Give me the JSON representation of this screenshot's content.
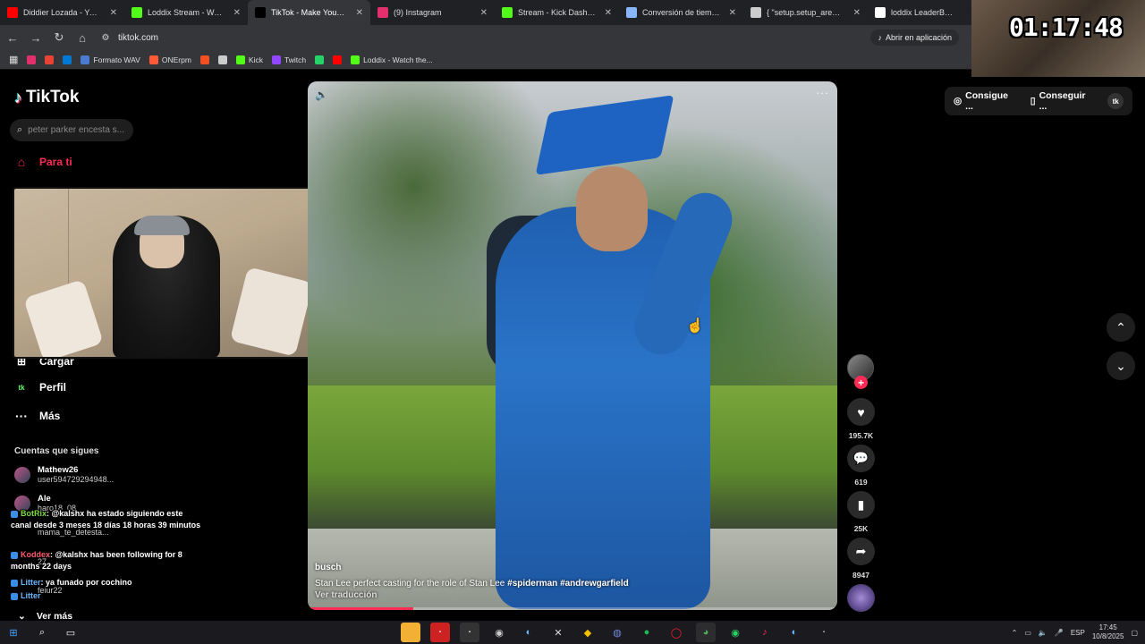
{
  "browser": {
    "tabs": [
      {
        "title": "Diddier Lozada - YouTube",
        "icon": "youtube-icon",
        "color": "#ff0000",
        "active": false
      },
      {
        "title": "Loddix Stream - Watch Live",
        "icon": "kick-icon",
        "color": "#53fc18",
        "active": false
      },
      {
        "title": "TikTok - Make Your Day",
        "icon": "tiktok-icon",
        "color": "#000000",
        "active": true
      },
      {
        "title": "(9) Instagram",
        "icon": "instagram-icon",
        "color": "#e1306c",
        "active": false
      },
      {
        "title": "Stream - Kick Dashboard",
        "icon": "kick-icon",
        "color": "#53fc18",
        "active": false
      },
      {
        "title": "Conversión de tiempo",
        "icon": "globe-icon",
        "color": "#8ab4f8",
        "active": false
      },
      {
        "title": "{ \"setup.setup_area_min_p",
        "icon": "document-icon",
        "color": "#cccccc",
        "active": false
      },
      {
        "title": "loddix LeaderBoard",
        "icon": "diamond-icon",
        "color": "#ffffff",
        "active": false
      }
    ],
    "url": "tiktok.com",
    "open_app_label": "Abrir en aplicación",
    "bookmarks": [
      {
        "label": "",
        "icon": "instagram-icon",
        "color": "#e1306c"
      },
      {
        "label": "",
        "icon": "gmail-icon",
        "color": "#ea4335"
      },
      {
        "label": "",
        "icon": "outlook-icon",
        "color": "#0078d4"
      },
      {
        "label": "Formato WAV",
        "icon": "note-icon",
        "color": "#4a7bd0"
      },
      {
        "label": "ONErpm",
        "icon": "onerpm-icon",
        "color": "#ff5a36"
      },
      {
        "label": "",
        "icon": "microsoft-icon",
        "color": "#f25022"
      },
      {
        "label": "",
        "icon": "chatgpt-icon",
        "color": "#cccccc"
      },
      {
        "label": "Kick",
        "icon": "kick-icon",
        "color": "#53fc18"
      },
      {
        "label": "Twitch",
        "icon": "twitch-icon",
        "color": "#9146ff"
      },
      {
        "label": "",
        "icon": "whatsapp-icon",
        "color": "#25d366"
      },
      {
        "label": "",
        "icon": "youtube-icon",
        "color": "#ff0000"
      },
      {
        "label": "Loddix - Watch the...",
        "icon": "kick-icon",
        "color": "#53fc18"
      }
    ]
  },
  "overlay": {
    "timer": "01:17:48"
  },
  "tiktok": {
    "logo": "TikTok",
    "search_placeholder": "peter parker encesta s...",
    "nav": [
      {
        "label": "Para ti",
        "icon": "home-icon",
        "active": true
      },
      {
        "label": "Cargar",
        "icon": "upload-icon",
        "active": false
      },
      {
        "label": "Perfil",
        "icon": "profile-icon",
        "active": false
      },
      {
        "label": "Más",
        "icon": "more-icon",
        "active": false
      }
    ],
    "following_title": "Cuentas que sigues",
    "following": [
      {
        "name": "Mathew26",
        "sub": "user594729294948..."
      },
      {
        "name": "Ale",
        "sub": "haro18_08"
      },
      {
        "name": "",
        "sub": "mama_te_detesta..."
      },
      {
        "name": "",
        "sub": "27"
      },
      {
        "name": "",
        "sub": "feiur22"
      }
    ],
    "see_more": "Ver más",
    "top_buttons": [
      "Consigue ...",
      "Conseguir ..."
    ],
    "video": {
      "author": "busch",
      "caption": "Stan Lee perfect casting for the role of Stan Lee",
      "hashtags": [
        "#spiderman",
        "#andrewgarfield"
      ],
      "translate": "Ver traducción",
      "progress": 0.2
    },
    "actions": {
      "likes": "195.7K",
      "comments": "619",
      "saves": "25K",
      "shares": "8947"
    }
  },
  "chat": [
    {
      "user": "BotRix",
      "user_class": "u1",
      "text": ": @kalshx ha estado siguiendo este canal desde 3 meses 18 días 18 horas 39 minutos"
    },
    {
      "user": "Koddex",
      "user_class": "u2",
      "text": ": @kalshx has been following for 8 months 22 days"
    },
    {
      "user": "Litter",
      "user_class": "u3",
      "text": ": ya funado por cochino"
    },
    {
      "user": "Litter",
      "user_class": "u3",
      "text": ""
    }
  ],
  "taskbar": {
    "language": "ESP",
    "time": "17:45",
    "date": "10/8/2025"
  }
}
